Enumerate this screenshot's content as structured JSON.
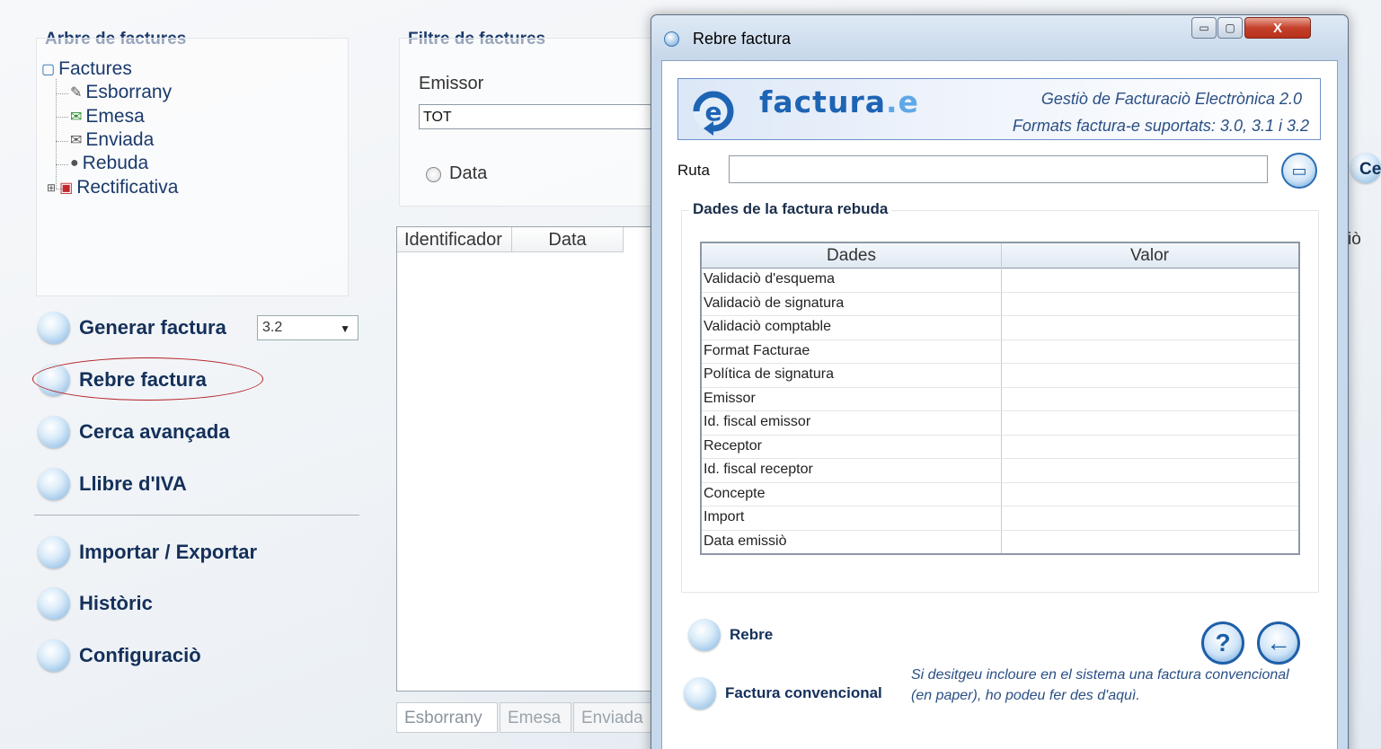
{
  "tree": {
    "title": "Arbre de factures",
    "root": "Factures",
    "items": [
      "Esborrany",
      "Emesa",
      "Enviada",
      "Rebuda",
      "Rectificativa"
    ]
  },
  "nav": {
    "generar": "Generar factura",
    "version": "3.2",
    "rebre": "Rebre factura",
    "cerca": "Cerca avançada",
    "llibre": "Llibre d'IVA",
    "importar": "Importar / Exportar",
    "historic": "Històric",
    "config": "Configuraciò"
  },
  "filter": {
    "title": "Filtre de factures",
    "emissor_label": "Emissor",
    "emissor_value": "TOT",
    "data_label": "Data"
  },
  "list": {
    "columns": [
      "Identificador",
      "Data"
    ],
    "tabs": [
      "Esborrany",
      "Emesa",
      "Enviada"
    ],
    "right_edge_1": "Ce",
    "right_edge_2": "iò"
  },
  "dialog": {
    "title": "Rebre factura",
    "logo": "factura",
    "logo_suffix": ".e",
    "banner_line1": "Gestiò de Facturaciò Electrònica 2.0",
    "banner_line2": "Formats factura-e suportats: 3.0, 3.1 i 3.2",
    "ruta_label": "Ruta",
    "ruta_value": "",
    "group_title": "Dades de la factura rebuda",
    "table_headers": [
      "Dades",
      "Valor"
    ],
    "rows": [
      "Validaciò d'esquema",
      "Validaciò de signatura",
      "Validaciò comptable",
      "Format Facturae",
      "Política de signatura",
      "Emissor",
      "Id. fiscal emissor",
      "Receptor",
      "Id. fiscal receptor",
      "Concepte",
      "Import",
      "Data emissiò"
    ],
    "rebre_label": "Rebre",
    "convencional_label": "Factura convencional",
    "hint_line1": "Si desitgeu incloure en el sistema una factura convencional",
    "hint_line2": "(en paper), ho podeu fer des d'aquì."
  }
}
